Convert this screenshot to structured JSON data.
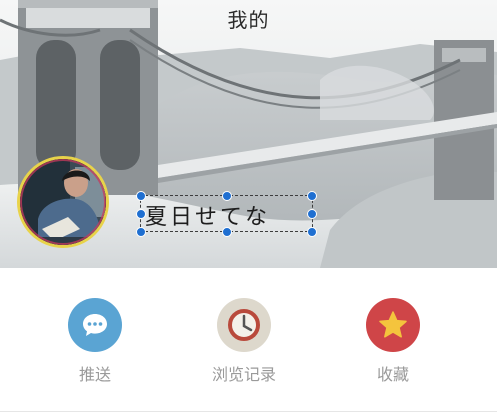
{
  "header": {
    "title": "我的"
  },
  "profile": {
    "username": "夏日せてな"
  },
  "actions": [
    {
      "label": "推送",
      "icon": "chat-bubble-icon",
      "color": "#5aa4d3"
    },
    {
      "label": "浏览记录",
      "icon": "clock-icon",
      "color": "#ddd8cc"
    },
    {
      "label": "收藏",
      "icon": "star-icon",
      "color": "#cf4548"
    }
  ]
}
